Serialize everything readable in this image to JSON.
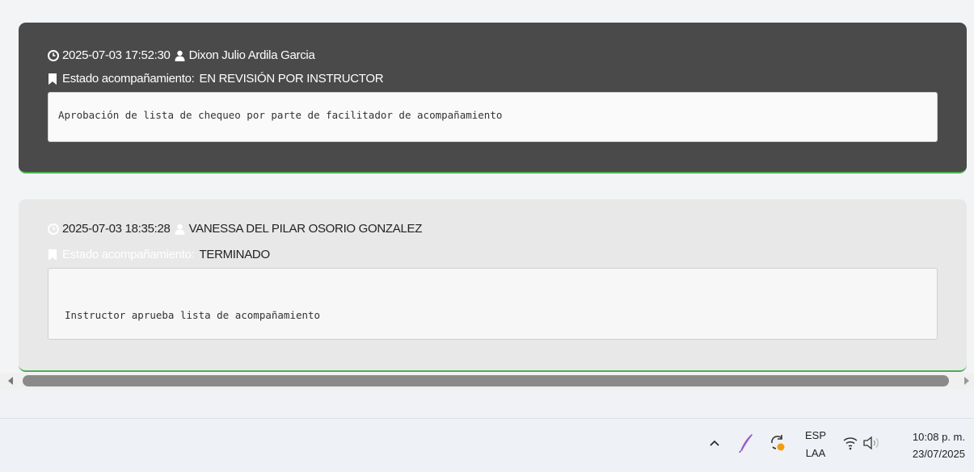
{
  "entries": [
    {
      "timestamp": "2025-07-03 17:52:30",
      "user": "Dixon Julio Ardila Garcia",
      "status_label": "Estado acompañamiento:",
      "status_value": "EN REVISIÓN POR INSTRUCTOR",
      "comment": "Aprobación de lista de chequeo por parte de facilitador de acompañamiento"
    },
    {
      "timestamp": "2025-07-03 18:35:28",
      "user": "VANESSA DEL PILAR OSORIO GONZALEZ",
      "status_label": "Estado acompañamiento:",
      "status_value": "TERMINADO",
      "comment": "Instructor aprueba lista de acompañamiento"
    }
  ],
  "taskbar": {
    "lang_primary": "ESP",
    "lang_secondary": "LAA",
    "time": "10:08 p. m.",
    "date": "23/07/2025",
    "icons": [
      "chevron-up-icon",
      "pen-icon",
      "sync-icon",
      "wifi-icon",
      "volume-icon"
    ]
  }
}
